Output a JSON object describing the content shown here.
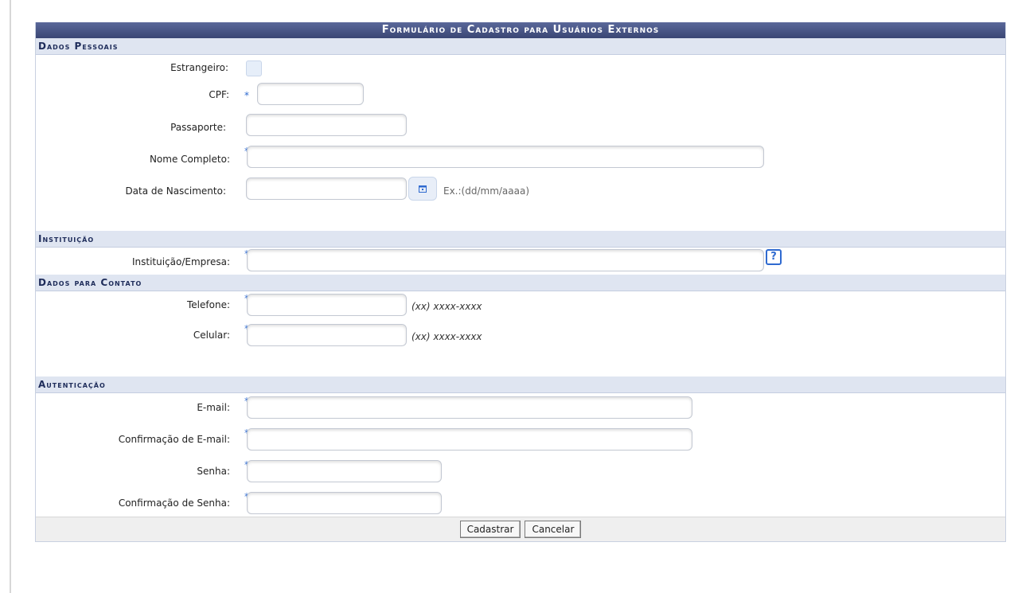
{
  "form": {
    "title": "Formulário de Cadastro para Usuários Externos"
  },
  "sections": {
    "personal": "Dados Pessoais",
    "institution": "Instituição",
    "contact": "Dados para Contato",
    "auth": "Autenticação"
  },
  "fields": {
    "foreigner": {
      "label": "Estrangeiro:",
      "checked": false
    },
    "cpf": {
      "label": "CPF:",
      "value": ""
    },
    "passport": {
      "label": "Passaporte:",
      "value": ""
    },
    "full_name": {
      "label": "Nome Completo:",
      "value": ""
    },
    "birth_date": {
      "label": "Data de Nascimento:",
      "value": "",
      "hint": "Ex.:(dd/mm/aaaa)"
    },
    "institution": {
      "label": "Instituição/Empresa:",
      "value": ""
    },
    "phone": {
      "label": "Telefone:",
      "value": "",
      "hint": "(xx) xxxx-xxxx"
    },
    "mobile": {
      "label": "Celular:",
      "value": "",
      "hint": "(xx) xxxx-xxxx"
    },
    "email": {
      "label": "E-mail:",
      "value": ""
    },
    "email_confirm": {
      "label": "Confirmação de E-mail:",
      "value": ""
    },
    "password": {
      "label": "Senha:",
      "value": ""
    },
    "password_confirm": {
      "label": "Confirmação de Senha:",
      "value": ""
    }
  },
  "required_mark": "*",
  "help_label": "?",
  "buttons": {
    "submit": "Cadastrar",
    "cancel": "Cancelar"
  },
  "icons": {
    "calendar": "calendar-icon",
    "help": "help-icon",
    "required": "required-star-icon"
  },
  "colors": {
    "title_bar": "#3f4d7e",
    "section_bg": "#dfe5f1",
    "required_star": "#2f6ad0"
  }
}
